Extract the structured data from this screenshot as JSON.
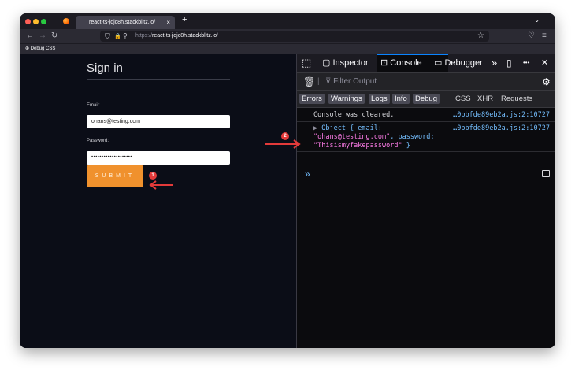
{
  "browser": {
    "tab_title": "react-ts-jqjc8h.stackblitz.io/",
    "tab_close": "×",
    "new_tab": "+",
    "tab_menu": "⌄",
    "back": "←",
    "forward": "→",
    "reload": "↻",
    "shield": "⛉",
    "lock": "🔒",
    "url_prefix": "https://",
    "url_host": "react-ts-jqjc8h.stackblitz.io",
    "url_path": "/",
    "star": "☆",
    "pocket": "♡",
    "menu": "≡",
    "bookmark_label": "Debug CSS",
    "traffic_colors": [
      "#ff5f57",
      "#febc2e",
      "#28c840"
    ]
  },
  "page": {
    "title": "Sign in",
    "email_label": "Email:",
    "email_value": "ohans@testing.com",
    "password_label": "Password:",
    "password_value": "••••••••••••••••••••",
    "submit_label": "SUBMIT",
    "accent_color": "#f0912d"
  },
  "devtools": {
    "tabs": [
      "Inspector",
      "Console",
      "Debugger"
    ],
    "active_tab": "Console",
    "more": "»",
    "close": "✕",
    "ellipsis": "•••",
    "filter_placeholder": "Filter Output",
    "levels": [
      "Errors",
      "Warnings",
      "Logs",
      "Info",
      "Debug"
    ],
    "categories": [
      "CSS",
      "XHR",
      "Requests"
    ],
    "messages": [
      {
        "text": "Console was cleared.",
        "source": "…0bbfde89eb2a.js:2:10727"
      },
      {
        "expander": "▶",
        "prefix": "Object { email:",
        "email_value": "\"ohans@testing.com\"",
        "password_key": ", password:",
        "password_value": "\"Thisismyfakepassword\"",
        "suffix": " }",
        "source": "…0bbfde89eb2a.js:2:10727"
      }
    ],
    "prompt": "»"
  },
  "annotations": [
    {
      "number": "1",
      "color": "#e43a3a"
    },
    {
      "number": "2",
      "color": "#e43a3a"
    }
  ]
}
